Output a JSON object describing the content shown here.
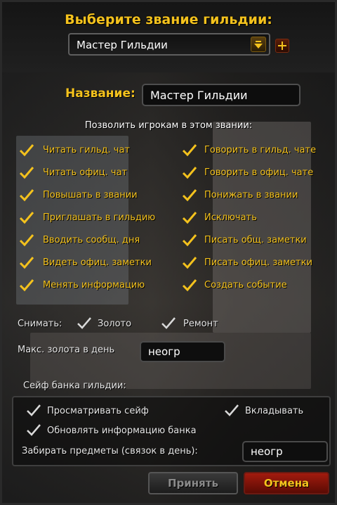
{
  "title": "Выберите звание гильдии:",
  "rank_dropdown": {
    "selected": "Мастер Гильдии"
  },
  "name_field": {
    "label": "Название:",
    "value": "Мастер Гильдии"
  },
  "permissions": {
    "heading": "Позволить игрокам в этом звании:",
    "left": [
      "Читать гильд. чат",
      "Читать офиц. чат",
      "Повышать в звании",
      "Приглашать в гильдию",
      "Вводить сообщ. дня",
      "Видеть офиц. заметки",
      "Менять информацию"
    ],
    "right": [
      "Говорить в гильд. чате",
      "Говорить в офиц. чате",
      "Понижать в звании",
      "Исключать",
      "Писать общ. заметки",
      "Писать офиц. заметки",
      "Создать событие"
    ]
  },
  "withdraw": {
    "label": "Снимать:",
    "gold": "Золото",
    "repair": "Ремонт"
  },
  "max_gold": {
    "label": "Макс. золота в день",
    "value": "неогр"
  },
  "vault": {
    "heading": "Сейф банка гильдии:",
    "view": "Просматривать сейф",
    "deposit": "Вкладывать",
    "update_info": "Обновлять информацию банка",
    "withdraw_label": "Забирать предметы (связок в день):",
    "withdraw_value": "неогр"
  },
  "buttons": {
    "accept": "Принять",
    "cancel": "Отмена"
  },
  "colors": {
    "gold_text": "#f4c21d",
    "check": "#f4c21d",
    "cancel_red": "#a21b0e"
  },
  "icons": {
    "check": "checkmark-icon",
    "dropdown": "arrow-down-icon",
    "add": "plus-icon"
  }
}
